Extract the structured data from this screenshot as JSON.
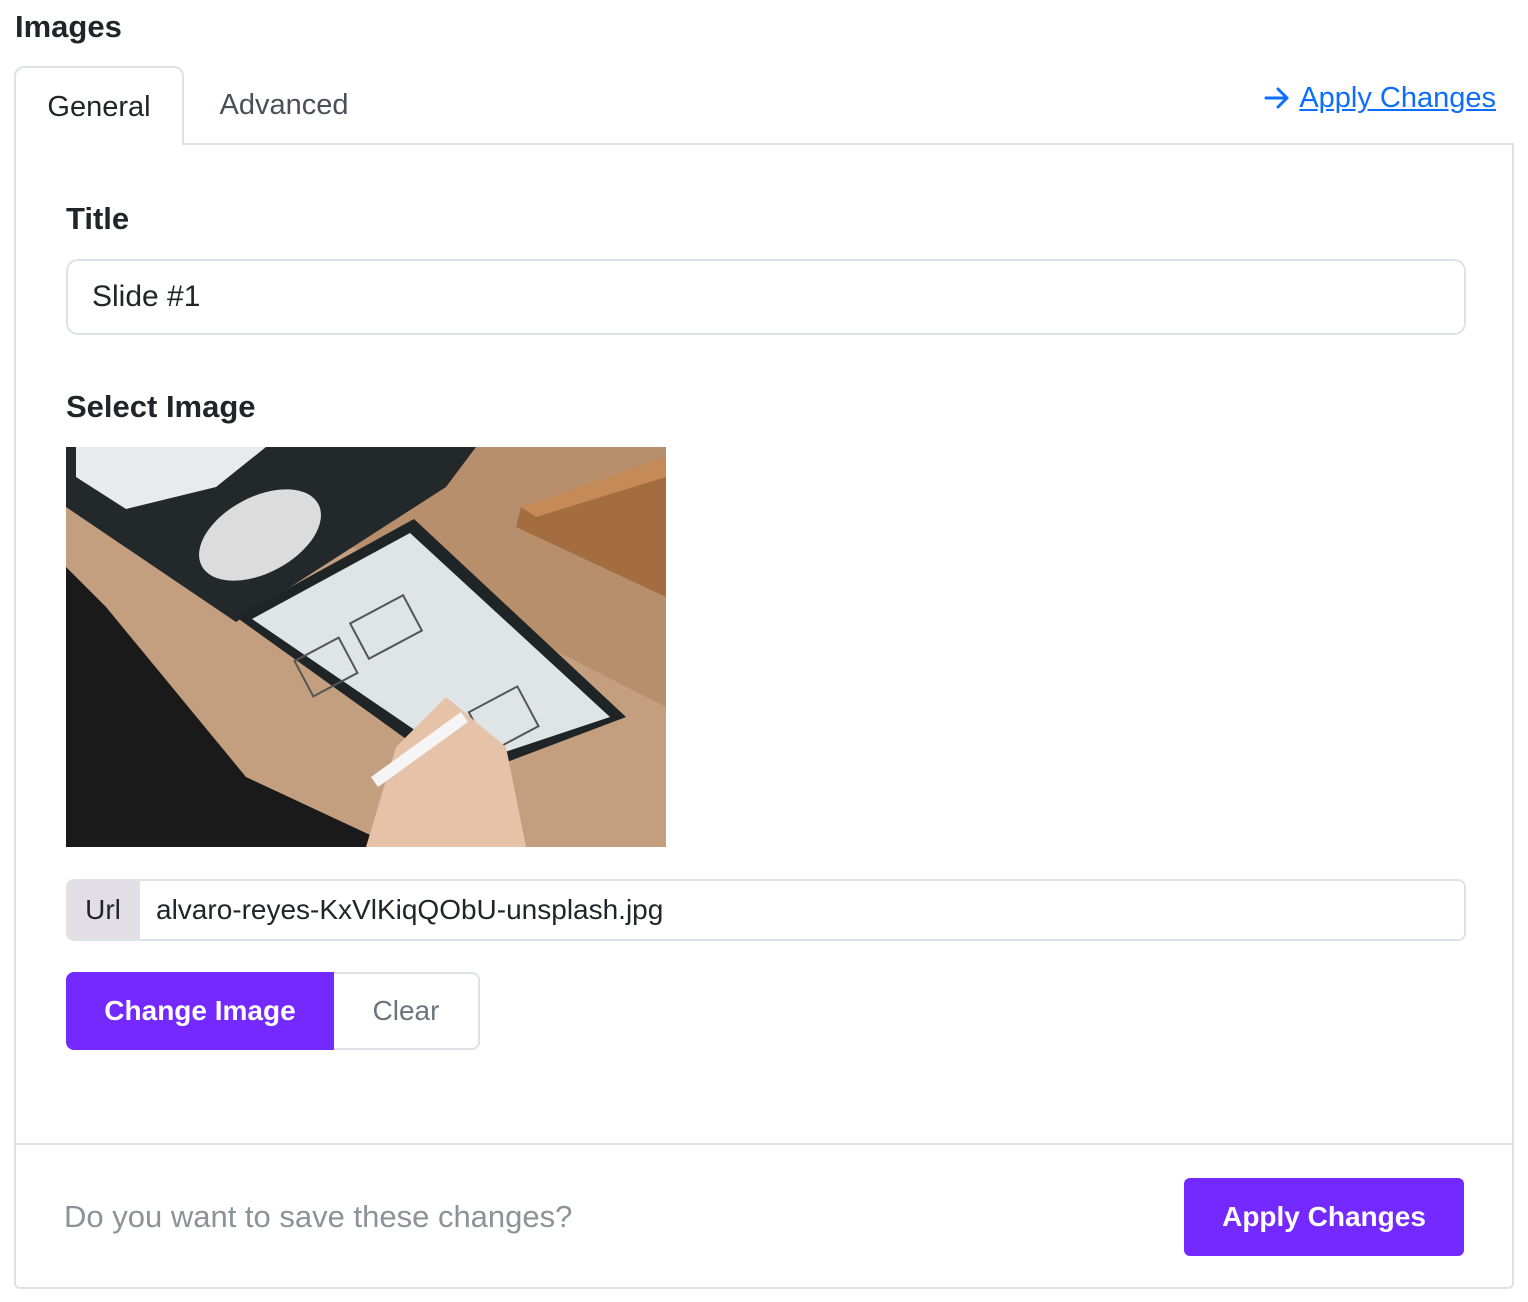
{
  "page": {
    "heading": "Images"
  },
  "tabs": [
    {
      "label": "General",
      "active": true
    },
    {
      "label": "Advanced",
      "active": false
    }
  ],
  "top_link": {
    "label": "Apply Changes",
    "icon": "arrow-right-icon",
    "color": "#0d6efd"
  },
  "form": {
    "title_label": "Title",
    "title_value": "Slide #1",
    "select_image_label": "Select Image",
    "url_addon": "Url",
    "url_value": "alvaro-reyes-KxVlKiqQObU-unsplash.jpg",
    "change_image_label": "Change Image",
    "clear_label": "Clear"
  },
  "footer": {
    "prompt": "Do you want to save these changes?",
    "apply_label": "Apply Changes"
  },
  "colors": {
    "primary": "#7329ff",
    "link": "#0d6efd",
    "border": "#dee2e6"
  }
}
